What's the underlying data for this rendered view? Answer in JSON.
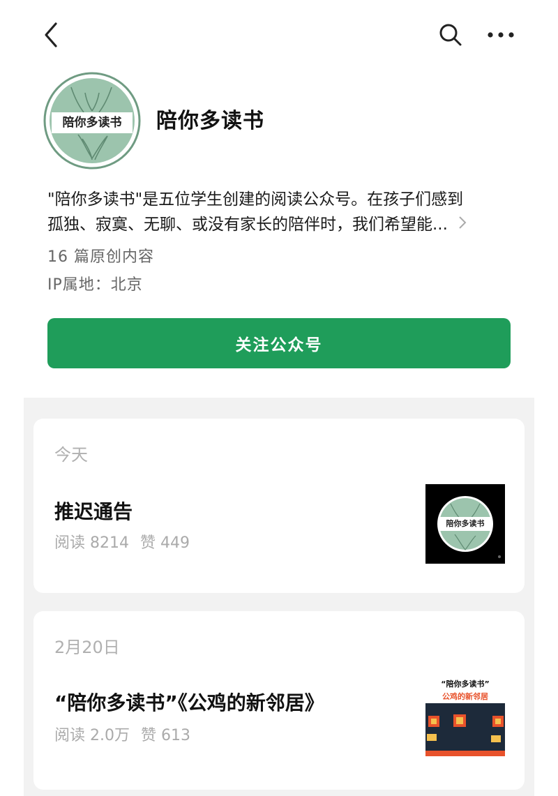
{
  "account": {
    "name": "陪你多读书",
    "avatar_text": "陪你多读书",
    "description_line1": "\"陪你多读书\"是五位学生创建的阅读公众号。在孩子们感到",
    "description_line2": "孤独、寂寞、无聊、或没有家长的陪伴时，我们希望能...",
    "original_count": "16 篇原创内容",
    "ip_location": "IP属地：北京",
    "follow_label": "关注公众号"
  },
  "icons": {
    "back": "back-arrow-icon",
    "search": "search-icon",
    "more": "more-dots-icon",
    "expand": "chevron-right-icon"
  },
  "colors": {
    "accent_green": "#1f9d5a",
    "avatar_green": "#9cc4ad",
    "feed_bg": "#f2f2f2"
  },
  "articles": [
    {
      "date": "今天",
      "title": "推迟通告",
      "reads": "阅读 8214",
      "likes": "赞 449",
      "thumb_text": "陪你多读书"
    },
    {
      "date": "2月20日",
      "title": "“陪你多读书”《公鸡的新邻居》",
      "reads": "阅读 2.0万",
      "likes": "赞 613",
      "thumb_text_top": "“陪你多读书”",
      "thumb_text_sub": "公鸡的新邻居"
    }
  ]
}
